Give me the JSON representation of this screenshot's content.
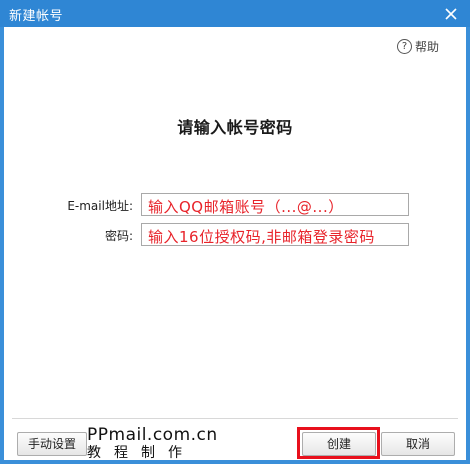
{
  "window": {
    "title": "新建帐号",
    "close_icon": "close-icon"
  },
  "help": {
    "icon": "help-circle-icon",
    "label": "帮助"
  },
  "heading": "请输入帐号密码",
  "form": {
    "email_label": "E-mail地址:",
    "email_value": "输入QQ邮箱账号（...@...）",
    "password_label": "密码:",
    "password_value": "输入16位授权码,非邮箱登录密码"
  },
  "footer": {
    "manual_label": "手动设置",
    "create_label": "创建",
    "cancel_label": "取消"
  },
  "watermark": {
    "domain": "PPmail.com.cn",
    "subtitle": "教程制作"
  },
  "colors": {
    "titlebar": "#2f86d4",
    "hint_text": "#e8232a",
    "highlight": "#e8101c"
  }
}
